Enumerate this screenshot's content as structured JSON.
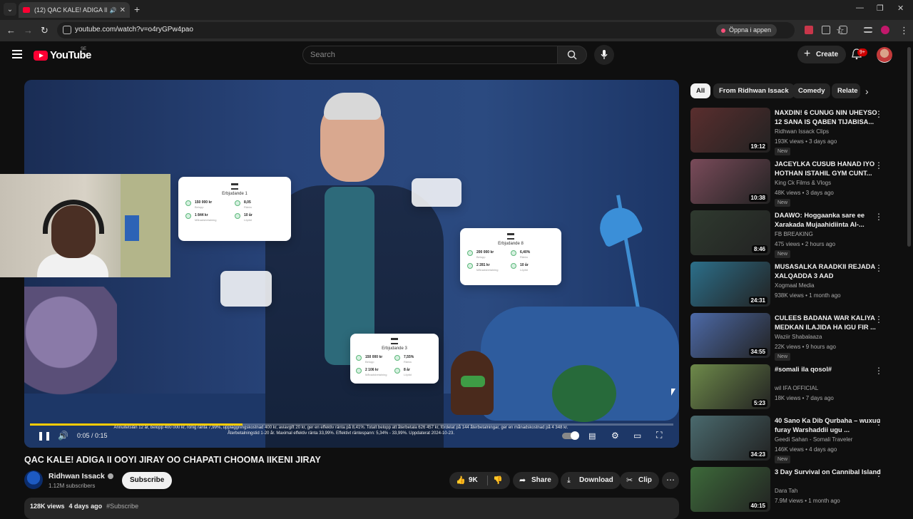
{
  "browser": {
    "tab_title": "(12) QAC KALE! ADIGA II OOYI",
    "url": "youtube.com/watch?v=o4ryGPw4pao",
    "open_in_app": "Öppna i appen",
    "colors": {
      "favicon": "#ff0033",
      "chrome_bg": "#2b2b2b",
      "tabstrip_bg": "#1f1f1f"
    }
  },
  "header": {
    "logo_text": "YouTube",
    "country_code": "SE",
    "search_placeholder": "Search",
    "create_label": "Create",
    "notifications_badge": "9+"
  },
  "player": {
    "time": "0:05 / 0:15",
    "progress": 0.33,
    "caption": "Annuitetslån 12 år, belopp 400 000 kr, rörlig ränta 7,99%, uppläggningskostnad 400 kr, aviavgift 20 kr, ger en effektiv ränta på 8,41%. Totalt belopp att återbetala 626 457 kr, fördelat på 144 återbetalningar, ger en månadskostnad på 4 348 kr. Återbetalningstid 1-20 år. Maximal effektiv ränta 33,99%. Effektivt räntespann: 5,34% - 33,99%. Uppdaterat 2024-10-23.",
    "cards": [
      {
        "title": "Erbjudande 1",
        "belopp": "150 000 kr",
        "ranta": "8,05",
        "manad": "1 844 kr",
        "tid": "10 år"
      },
      {
        "title": "Erbjudande 8",
        "belopp": "200 000 kr",
        "ranta": "6,40%",
        "manad": "2 281 kr",
        "tid": "10 år"
      },
      {
        "title": "Erbjudande 3",
        "belopp": "150 000 kr",
        "ranta": "7,55%",
        "manad": "2 106 kr",
        "tid": "8 år"
      }
    ],
    "card_labels": {
      "belopp": "Belopp",
      "ranta": "Ränta",
      "manad": "Månadsbetalning",
      "tid": "Löptid"
    }
  },
  "video": {
    "title": "QAC KALE! ADIGA II OOYI JIRAY OO CHAPATI CHOOMA IIKENI JIRAY",
    "channel": "Ridhwan Issack",
    "subscribers": "1.12M subscribers",
    "subscribe_label": "Subscribe",
    "likes": "9K",
    "share_label": "Share",
    "download_label": "Download",
    "clip_label": "Clip",
    "views": "128K views",
    "posted": "4 days ago",
    "hashtag": "#Subscribe"
  },
  "chips": [
    "All",
    "From Ridhwan Issack",
    "Comedy",
    "Relate"
  ],
  "recommendations": [
    {
      "title": "NAXDIN! 6 CUNUG NIN UHEYSO 12 SANA IS QABEN TIJABISA...",
      "channel": "Ridhwan Issack Clips",
      "meta": "193K views • 3 days ago",
      "duration": "19:12",
      "badge": "New",
      "thumb_color": "#5a2e2e"
    },
    {
      "title": "JACEYLKA CUSUB HANAD IYO HOTHAN ISTAHIL GYM CUNT...",
      "channel": "King Ck Films & Vlogs",
      "meta": "48K views • 3 days ago",
      "duration": "10:38",
      "badge": "New",
      "thumb_color": "#7a4b5a"
    },
    {
      "title": "DAAWO: Hoggaanka sare ee Xarakada Mujaahidiinta Al-...",
      "channel": "FB BREAKING",
      "meta": "475 views • 2 hours ago",
      "duration": "8:46",
      "badge": "New",
      "thumb_color": "#2f3a2f"
    },
    {
      "title": "MUSASALKA RAADKII REJADA XALQADDA 3 AAD",
      "channel": "Xogmaal Media",
      "meta": "938K views • 1 month ago",
      "duration": "24:31",
      "badge": "",
      "thumb_color": "#2c6f8a"
    },
    {
      "title": "CULEES BADANA WAR KALIYA MEDKAN ILAJIDA HA IGU FIR ...",
      "channel": "Waziir Shabalaaza",
      "meta": "22K views • 9 hours ago",
      "duration": "34:55",
      "badge": "New",
      "thumb_color": "#4d6aa8"
    },
    {
      "title": "#somali ila qosol#",
      "channel": "wil IFA OFFICIAL",
      "meta": "18K views • 7 days ago",
      "duration": "5:23",
      "badge": "",
      "thumb_color": "#6e8a4a"
    },
    {
      "title": "40 Sano Ka Dib Qurbaha – wuxuu furay Warshaddii ugu ...",
      "channel": "Geedi Sahan - Somali Traveler",
      "meta": "146K views • 4 days ago",
      "duration": "34:23",
      "badge": "New",
      "thumb_color": "#4a6a6e"
    },
    {
      "title": "3 Day Survival on Cannibal Island",
      "channel": "Dara Tah",
      "meta": "7.9M views • 1 month ago",
      "duration": "40:15",
      "badge": "",
      "thumb_color": "#3d6a3a"
    }
  ]
}
